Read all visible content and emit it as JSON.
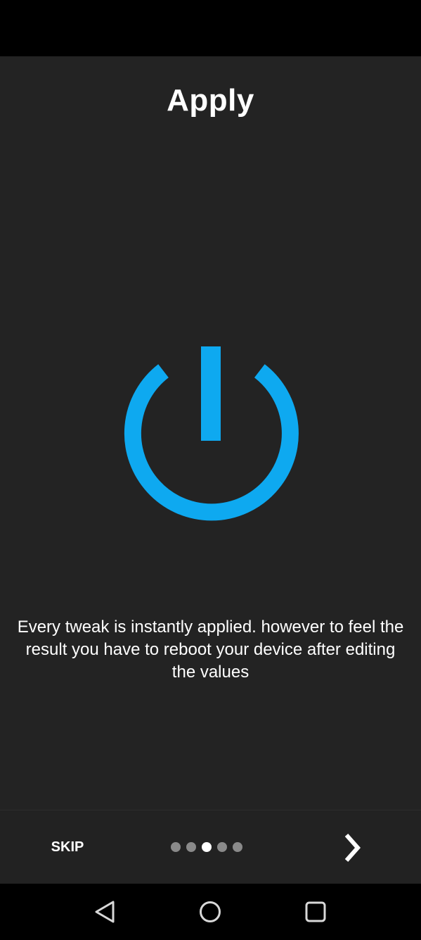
{
  "onboarding": {
    "title": "Apply",
    "description": "Every tweak is instantly applied. however to feel the result you have to reboot your device after editing the values",
    "hero_icon": "power-icon",
    "accent_color": "#0ea9f0"
  },
  "bottom_bar": {
    "skip_label": "SKIP",
    "page_count": 5,
    "current_page": 3,
    "next_icon": "chevron-right-icon"
  },
  "nav_bar": {
    "back_icon": "back-triangle-icon",
    "home_icon": "home-circle-icon",
    "recents_icon": "recents-square-icon"
  }
}
